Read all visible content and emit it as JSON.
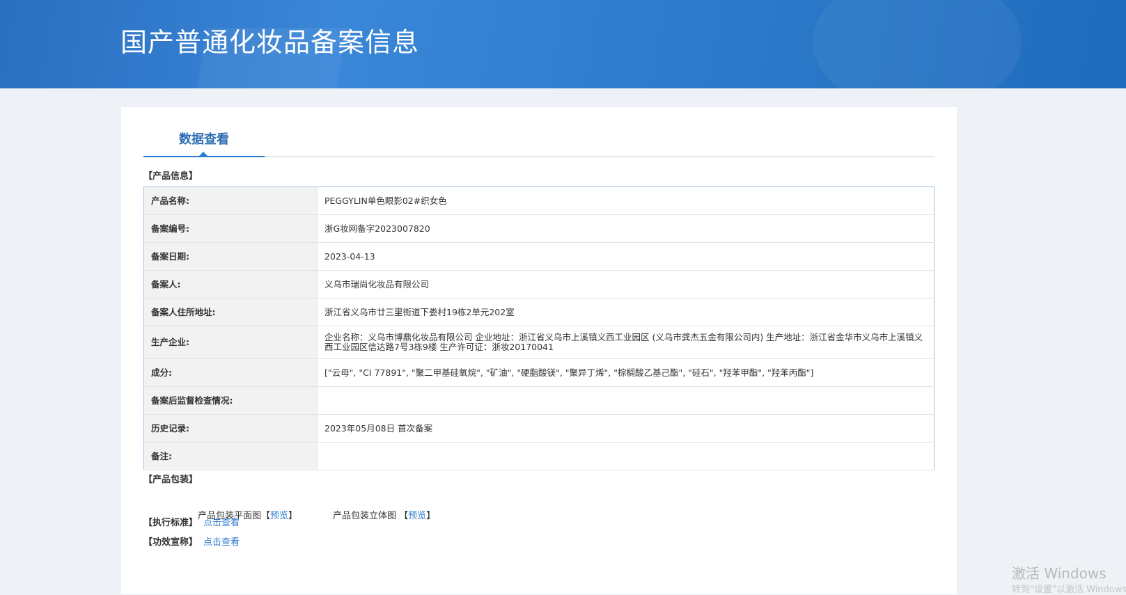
{
  "header": {
    "title": "国产普通化妆品备案信息"
  },
  "tabs": [
    {
      "label": "数据查看",
      "active": true
    }
  ],
  "product_info": {
    "section_label": "【产品信息】",
    "rows": [
      {
        "key": "产品名称:",
        "value": "PEGGYLIN单色眼影02#织女色"
      },
      {
        "key": "备案编号:",
        "value": "浙G妆网备字2023007820"
      },
      {
        "key": "备案日期:",
        "value": "2023-04-13"
      },
      {
        "key": "备案人:",
        "value": "义乌市瑞尚化妆品有限公司"
      },
      {
        "key": "备案人住所地址:",
        "value": "浙江省义乌市廿三里街道下娄村19栋2单元202室"
      },
      {
        "key": "生产企业:",
        "value": "企业名称：义乌市博鼎化妆品有限公司 企业地址：浙江省义乌市上溪镇义西工业园区 (义乌市龚杰五金有限公司内) 生产地址：浙江省金华市义乌市上溪镇义西工业园区信达路7号3栋9楼 生产许可证：浙妆20170041"
      },
      {
        "key": "成分:",
        "value": "[\"云母\", \"CI 77891\", \"聚二甲基硅氧烷\", \"矿油\", \"硬脂酸镁\", \"聚异丁烯\", \"棕榈酸乙基己酯\", \"硅石\", \"羟苯甲酯\", \"羟苯丙酯\"]"
      },
      {
        "key": "备案后监督检查情况:",
        "value": ""
      },
      {
        "key": "历史记录:",
        "value": "2023年05月08日 首次备案"
      },
      {
        "key": "备注:",
        "value": ""
      }
    ]
  },
  "packaging": {
    "section_label": "【产品包装】",
    "flat_label": "产品包装平面图",
    "flat_link": "预览",
    "solid_label": "产品包装立体图",
    "solid_link": "预览",
    "bracket_open": "【",
    "bracket_close": "】"
  },
  "standard": {
    "label": "【执行标准】",
    "link": "点击查看"
  },
  "efficacy": {
    "label": "【功效宣称】",
    "link": "点击查看"
  },
  "watermark": {
    "line1": "激活 Windows",
    "line2": "转到\"设置\"以激活 Windows。"
  }
}
